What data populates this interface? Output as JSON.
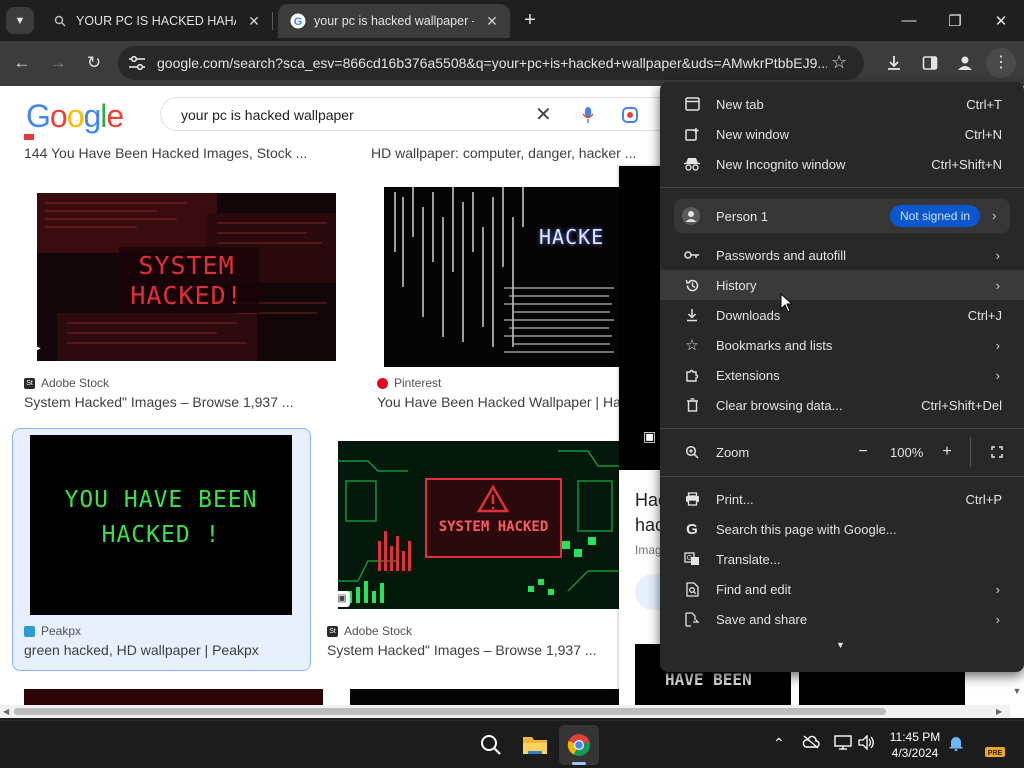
{
  "browser": {
    "tabs": [
      {
        "title": "YOUR PC IS HACKED HAHAHAHA",
        "active": false
      },
      {
        "title": "your pc is hacked wallpaper - G",
        "active": true
      }
    ],
    "url": "google.com/search?sca_esv=866cd16b376a5508&q=your+pc+is+hacked+wallpaper&uds=AMwkrPtbbEJ9..."
  },
  "google": {
    "logo": "Google",
    "query": "your pc is hacked wallpaper"
  },
  "results": {
    "top_row": [
      {
        "title": "144 You Have Been Hacked Images, Stock ..."
      },
      {
        "title": "HD wallpaper: computer, danger, hacker ..."
      }
    ],
    "row1": [
      {
        "thumb_text": [
          "SYSTEM",
          "HACKED!"
        ],
        "source": "Adobe Stock",
        "title": "System Hacked\" Images – Browse 1,937 ..."
      },
      {
        "thumb_text": "HACKE",
        "source": "Pinterest",
        "title": "You Have Been Hacked Wallpaper | Ha"
      }
    ],
    "row2": [
      {
        "thumb_text": [
          "YOU HAVE BEEN",
          "HACKED !"
        ],
        "source": "Peakpx",
        "title": "green hacked, HD wallpaper | Peakpx"
      },
      {
        "thumb_text": "SYSTEM HACKED",
        "source": "Adobe Stock",
        "title": "System Hacked\" Images – Browse 1,937 ..."
      }
    ],
    "side_panel": {
      "title_partial": [
        "Hac",
        "hac"
      ],
      "source_partial": "Imag",
      "thumb_text": "HAVE BEEN"
    }
  },
  "menu": {
    "items_top": [
      {
        "label": "New tab",
        "shortcut": "Ctrl+T",
        "icon": "new-tab-icon"
      },
      {
        "label": "New window",
        "shortcut": "Ctrl+N",
        "icon": "new-window-icon"
      },
      {
        "label": "New Incognito window",
        "shortcut": "Ctrl+Shift+N",
        "icon": "incognito-icon"
      }
    ],
    "profile": {
      "name": "Person 1",
      "status": "Not signed in"
    },
    "items_mid": [
      {
        "label": "Passwords and autofill",
        "shortcut": "",
        "icon": "key-icon"
      },
      {
        "label": "History",
        "shortcut": "",
        "icon": "history-icon"
      },
      {
        "label": "Downloads",
        "shortcut": "Ctrl+J",
        "icon": "download-icon"
      },
      {
        "label": "Bookmarks and lists",
        "shortcut": "",
        "icon": "star-icon"
      },
      {
        "label": "Extensions",
        "shortcut": "",
        "icon": "extension-icon"
      },
      {
        "label": "Clear browsing data...",
        "shortcut": "Ctrl+Shift+Del",
        "icon": "trash-icon"
      }
    ],
    "zoom": {
      "label": "Zoom",
      "value": "100%"
    },
    "items_bottom": [
      {
        "label": "Print...",
        "shortcut": "Ctrl+P",
        "icon": "print-icon"
      },
      {
        "label": "Search this page with Google...",
        "shortcut": "",
        "icon": "google-g-icon"
      },
      {
        "label": "Translate...",
        "shortcut": "",
        "icon": "translate-icon"
      },
      {
        "label": "Find and edit",
        "shortcut": "",
        "icon": "find-icon"
      },
      {
        "label": "Save and share",
        "shortcut": "",
        "icon": "share-icon"
      }
    ]
  },
  "taskbar": {
    "time": "11:45 PM",
    "date": "4/3/2024",
    "apps": [
      "search-icon",
      "file-explorer-icon",
      "chrome-icon"
    ]
  },
  "colors": {
    "chrome_dark": "#1f1f1f",
    "toolbar": "#3c3c3c",
    "menu_bg": "#282828",
    "badge_blue": "#0b57d0",
    "hacked_red": "#e0303a",
    "hacked_green": "#3ee04a"
  }
}
